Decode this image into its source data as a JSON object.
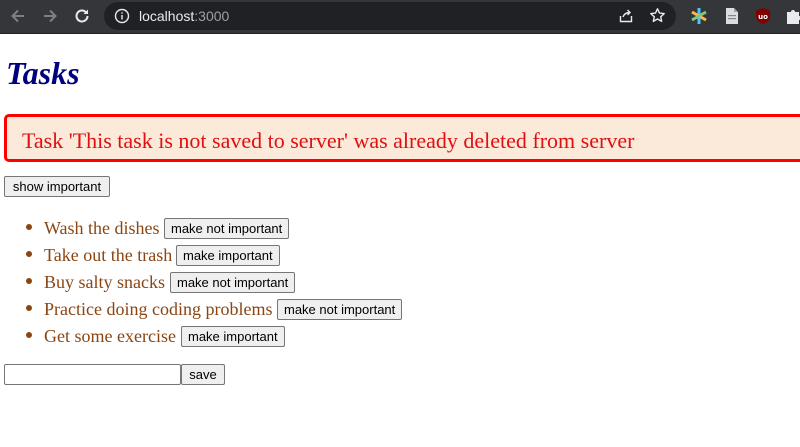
{
  "browser": {
    "url_host": "localhost",
    "url_port": ":3000"
  },
  "page": {
    "title": "Tasks",
    "alert_text": "Task 'This task is not saved to server' was already deleted from server",
    "show_important_label": "show important",
    "tasks": [
      {
        "text": "Wash the dishes",
        "button_label": "make not important"
      },
      {
        "text": "Take out the trash",
        "button_label": "make important"
      },
      {
        "text": "Buy salty snacks",
        "button_label": "make not important"
      },
      {
        "text": "Practice doing coding problems",
        "button_label": "make not important"
      },
      {
        "text": "Get some exercise",
        "button_label": "make important"
      }
    ],
    "new_task_value": "",
    "save_label": "save"
  },
  "colors": {
    "title": "#000080",
    "task_text": "#8b4513",
    "alert_border": "#ff0000",
    "alert_background": "#fbe9d9",
    "alert_text": "#e01010"
  },
  "icons": {
    "back": "arrow-left-icon",
    "forward": "arrow-right-icon",
    "reload": "reload-icon",
    "site_info": "info-icon",
    "share": "share-icon",
    "bookmark": "star-icon",
    "extensions": [
      "colorful-asterisk-extension-icon",
      "document-extension-icon",
      "ublock-extension-icon",
      "puzzle-icon"
    ]
  }
}
